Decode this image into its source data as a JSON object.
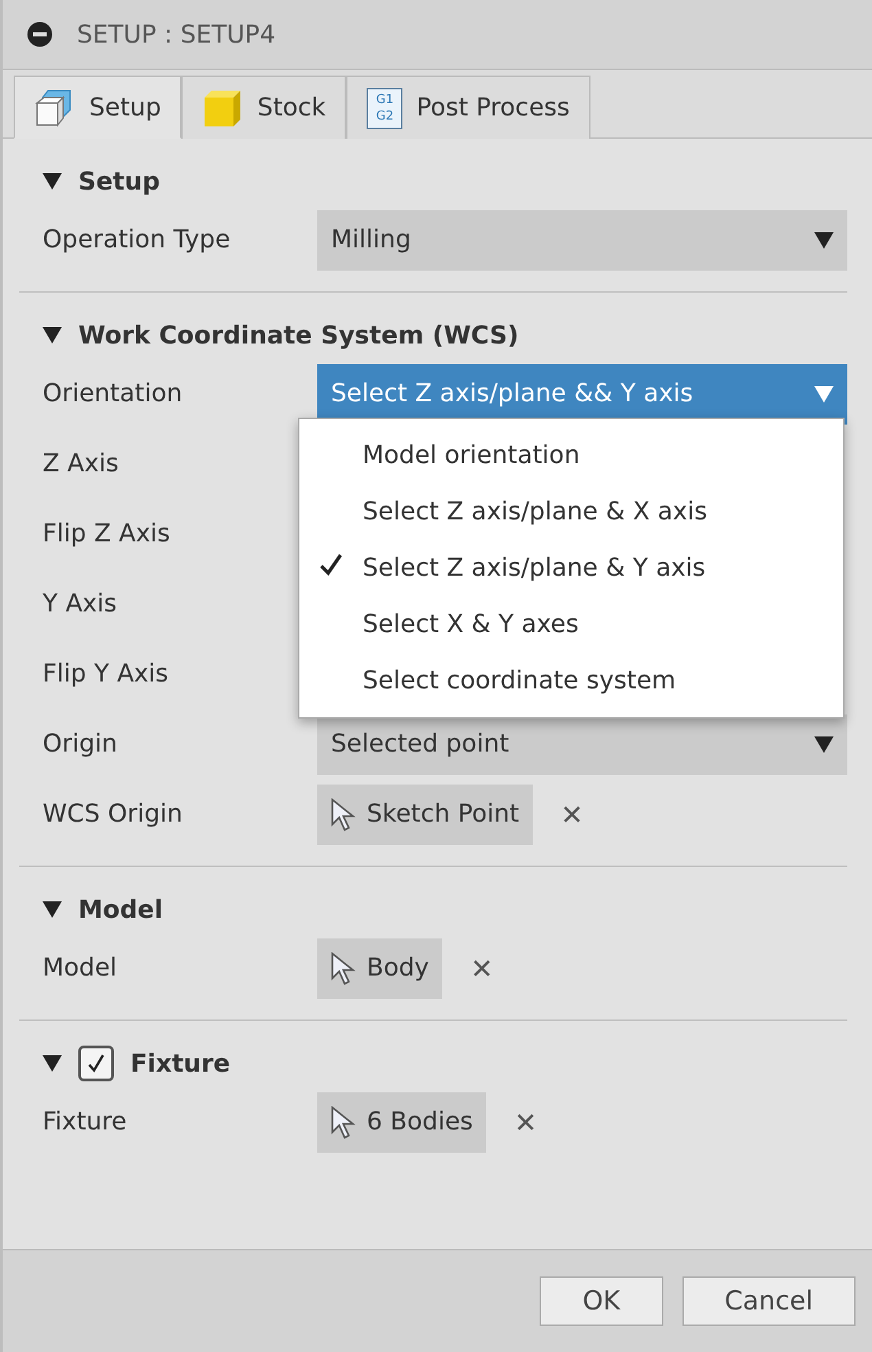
{
  "window": {
    "title": "SETUP : SETUP4"
  },
  "tabs": [
    {
      "label": "Setup",
      "kind": "setup",
      "selected": true
    },
    {
      "label": "Stock",
      "kind": "stock",
      "selected": false
    },
    {
      "label": "Post Process",
      "kind": "gcode",
      "icon_text": [
        "G1",
        "G2"
      ],
      "selected": false
    }
  ],
  "sections": [
    {
      "title": "Setup",
      "expanded": true,
      "rows": [
        {
          "kind": "dropdown",
          "label": "Operation Type",
          "value": "Milling",
          "open": false
        }
      ]
    },
    {
      "title": "Work Coordinate System (WCS)",
      "expanded": true,
      "rows": [
        {
          "kind": "dropdown",
          "label": "Orientation",
          "value": "Select Z axis/plane && Y axis",
          "open": true,
          "options": [
            {
              "label": "Model orientation",
              "selected": false
            },
            {
              "label": "Select Z axis/plane & X axis",
              "selected": false
            },
            {
              "label": "Select Z axis/plane & Y axis",
              "selected": true
            },
            {
              "label": "Select X & Y axes",
              "selected": false
            },
            {
              "label": "Select coordinate system",
              "selected": false
            }
          ]
        },
        {
          "kind": "covered",
          "label": "Z Axis"
        },
        {
          "kind": "covered",
          "label": "Flip Z Axis"
        },
        {
          "kind": "covered",
          "label": "Y Axis"
        },
        {
          "kind": "covered",
          "label": "Flip Y Axis"
        },
        {
          "kind": "dropdown",
          "label": "Origin",
          "value": "Selected point",
          "open": false
        },
        {
          "kind": "selection",
          "label": "WCS Origin",
          "value": "Sketch Point",
          "close": "✕"
        }
      ]
    },
    {
      "title": "Model",
      "expanded": true,
      "rows": [
        {
          "kind": "selection",
          "label": "Model",
          "value": "Body",
          "close": "✕"
        }
      ]
    },
    {
      "title": "Fixture",
      "expanded": true,
      "checked": true,
      "rows": [
        {
          "kind": "selection",
          "label": "Fixture",
          "value": "6 Bodies",
          "close": "✕"
        }
      ]
    }
  ],
  "buttons": [
    {
      "label": "OK"
    },
    {
      "label": "Cancel"
    }
  ]
}
